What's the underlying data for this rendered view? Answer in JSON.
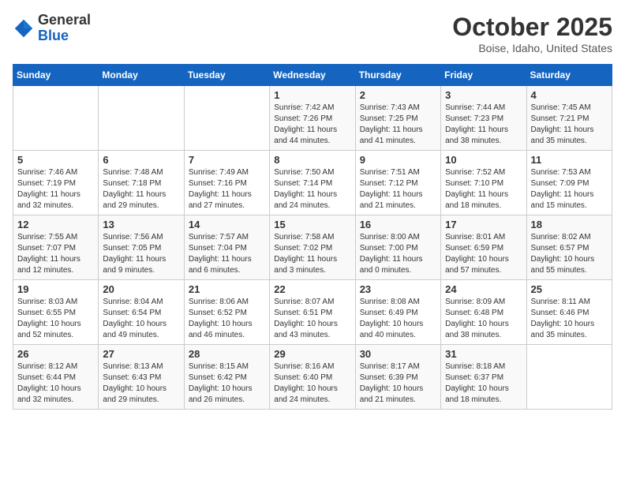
{
  "logo": {
    "general": "General",
    "blue": "Blue"
  },
  "header": {
    "month": "October 2025",
    "location": "Boise, Idaho, United States"
  },
  "weekdays": [
    "Sunday",
    "Monday",
    "Tuesday",
    "Wednesday",
    "Thursday",
    "Friday",
    "Saturday"
  ],
  "weeks": [
    [
      {
        "day": "",
        "info": ""
      },
      {
        "day": "",
        "info": ""
      },
      {
        "day": "",
        "info": ""
      },
      {
        "day": "1",
        "info": "Sunrise: 7:42 AM\nSunset: 7:26 PM\nDaylight: 11 hours\nand 44 minutes."
      },
      {
        "day": "2",
        "info": "Sunrise: 7:43 AM\nSunset: 7:25 PM\nDaylight: 11 hours\nand 41 minutes."
      },
      {
        "day": "3",
        "info": "Sunrise: 7:44 AM\nSunset: 7:23 PM\nDaylight: 11 hours\nand 38 minutes."
      },
      {
        "day": "4",
        "info": "Sunrise: 7:45 AM\nSunset: 7:21 PM\nDaylight: 11 hours\nand 35 minutes."
      }
    ],
    [
      {
        "day": "5",
        "info": "Sunrise: 7:46 AM\nSunset: 7:19 PM\nDaylight: 11 hours\nand 32 minutes."
      },
      {
        "day": "6",
        "info": "Sunrise: 7:48 AM\nSunset: 7:18 PM\nDaylight: 11 hours\nand 29 minutes."
      },
      {
        "day": "7",
        "info": "Sunrise: 7:49 AM\nSunset: 7:16 PM\nDaylight: 11 hours\nand 27 minutes."
      },
      {
        "day": "8",
        "info": "Sunrise: 7:50 AM\nSunset: 7:14 PM\nDaylight: 11 hours\nand 24 minutes."
      },
      {
        "day": "9",
        "info": "Sunrise: 7:51 AM\nSunset: 7:12 PM\nDaylight: 11 hours\nand 21 minutes."
      },
      {
        "day": "10",
        "info": "Sunrise: 7:52 AM\nSunset: 7:10 PM\nDaylight: 11 hours\nand 18 minutes."
      },
      {
        "day": "11",
        "info": "Sunrise: 7:53 AM\nSunset: 7:09 PM\nDaylight: 11 hours\nand 15 minutes."
      }
    ],
    [
      {
        "day": "12",
        "info": "Sunrise: 7:55 AM\nSunset: 7:07 PM\nDaylight: 11 hours\nand 12 minutes."
      },
      {
        "day": "13",
        "info": "Sunrise: 7:56 AM\nSunset: 7:05 PM\nDaylight: 11 hours\nand 9 minutes."
      },
      {
        "day": "14",
        "info": "Sunrise: 7:57 AM\nSunset: 7:04 PM\nDaylight: 11 hours\nand 6 minutes."
      },
      {
        "day": "15",
        "info": "Sunrise: 7:58 AM\nSunset: 7:02 PM\nDaylight: 11 hours\nand 3 minutes."
      },
      {
        "day": "16",
        "info": "Sunrise: 8:00 AM\nSunset: 7:00 PM\nDaylight: 11 hours\nand 0 minutes."
      },
      {
        "day": "17",
        "info": "Sunrise: 8:01 AM\nSunset: 6:59 PM\nDaylight: 10 hours\nand 57 minutes."
      },
      {
        "day": "18",
        "info": "Sunrise: 8:02 AM\nSunset: 6:57 PM\nDaylight: 10 hours\nand 55 minutes."
      }
    ],
    [
      {
        "day": "19",
        "info": "Sunrise: 8:03 AM\nSunset: 6:55 PM\nDaylight: 10 hours\nand 52 minutes."
      },
      {
        "day": "20",
        "info": "Sunrise: 8:04 AM\nSunset: 6:54 PM\nDaylight: 10 hours\nand 49 minutes."
      },
      {
        "day": "21",
        "info": "Sunrise: 8:06 AM\nSunset: 6:52 PM\nDaylight: 10 hours\nand 46 minutes."
      },
      {
        "day": "22",
        "info": "Sunrise: 8:07 AM\nSunset: 6:51 PM\nDaylight: 10 hours\nand 43 minutes."
      },
      {
        "day": "23",
        "info": "Sunrise: 8:08 AM\nSunset: 6:49 PM\nDaylight: 10 hours\nand 40 minutes."
      },
      {
        "day": "24",
        "info": "Sunrise: 8:09 AM\nSunset: 6:48 PM\nDaylight: 10 hours\nand 38 minutes."
      },
      {
        "day": "25",
        "info": "Sunrise: 8:11 AM\nSunset: 6:46 PM\nDaylight: 10 hours\nand 35 minutes."
      }
    ],
    [
      {
        "day": "26",
        "info": "Sunrise: 8:12 AM\nSunset: 6:44 PM\nDaylight: 10 hours\nand 32 minutes."
      },
      {
        "day": "27",
        "info": "Sunrise: 8:13 AM\nSunset: 6:43 PM\nDaylight: 10 hours\nand 29 minutes."
      },
      {
        "day": "28",
        "info": "Sunrise: 8:15 AM\nSunset: 6:42 PM\nDaylight: 10 hours\nand 26 minutes."
      },
      {
        "day": "29",
        "info": "Sunrise: 8:16 AM\nSunset: 6:40 PM\nDaylight: 10 hours\nand 24 minutes."
      },
      {
        "day": "30",
        "info": "Sunrise: 8:17 AM\nSunset: 6:39 PM\nDaylight: 10 hours\nand 21 minutes."
      },
      {
        "day": "31",
        "info": "Sunrise: 8:18 AM\nSunset: 6:37 PM\nDaylight: 10 hours\nand 18 minutes."
      },
      {
        "day": "",
        "info": ""
      }
    ]
  ]
}
